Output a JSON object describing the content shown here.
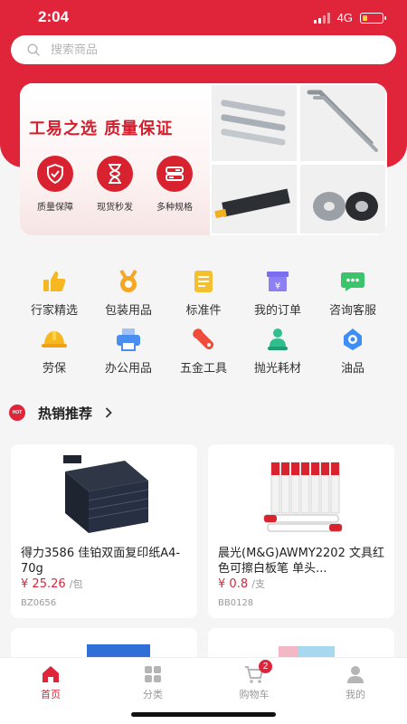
{
  "status_bar": {
    "time": "2:04",
    "network": "4G"
  },
  "search": {
    "placeholder": "搜索商品"
  },
  "banner": {
    "title": "工易之选 质量保证",
    "features": [
      {
        "label": "质量保障",
        "icon": "shield-icon"
      },
      {
        "label": "现货秒发",
        "icon": "hourglass-icon"
      },
      {
        "label": "多种规格",
        "icon": "spec-icon"
      }
    ]
  },
  "categories": [
    {
      "label": "行家精选",
      "icon": "thumbs-up-icon",
      "color": "#f5b820"
    },
    {
      "label": "包装用品",
      "icon": "medal-icon",
      "color": "#f5a623"
    },
    {
      "label": "标准件",
      "icon": "document-icon",
      "color": "#f5c030"
    },
    {
      "label": "我的订单",
      "icon": "order-icon",
      "color": "#7b6ef0"
    },
    {
      "label": "咨询客服",
      "icon": "chat-icon",
      "color": "#3cc46c"
    },
    {
      "label": "劳保",
      "icon": "helmet-icon",
      "color": "#f5b820"
    },
    {
      "label": "办公用品",
      "icon": "printer-icon",
      "color": "#4a8ef0"
    },
    {
      "label": "五金工具",
      "icon": "wrench-icon",
      "color": "#ef4d3c"
    },
    {
      "label": "抛光耗材",
      "icon": "polish-icon",
      "color": "#2fbf8c"
    },
    {
      "label": "油品",
      "icon": "oil-icon",
      "color": "#3e8ef5"
    }
  ],
  "hot_section": {
    "badge": "HOT",
    "title": "热销推荐"
  },
  "products": [
    {
      "name": "得力3586 佳铂双面复印纸A4-70g",
      "currency": "¥",
      "price": "25.26",
      "unit": "/包",
      "code": "BZ0656"
    },
    {
      "name": "晨光(M&G)AWMY2202 文具红色可擦白板笔 单头...",
      "currency": "¥",
      "price": "0.8",
      "unit": "/支",
      "code": "BB0128"
    }
  ],
  "tab_bar": {
    "tabs": [
      {
        "label": "首页",
        "icon": "home-icon"
      },
      {
        "label": "分类",
        "icon": "grid-icon"
      },
      {
        "label": "购物车",
        "icon": "cart-icon"
      },
      {
        "label": "我的",
        "icon": "user-icon"
      }
    ],
    "cart_count": "2"
  },
  "colors": {
    "brand": "#e0243a",
    "background": "#f5f5f5"
  }
}
